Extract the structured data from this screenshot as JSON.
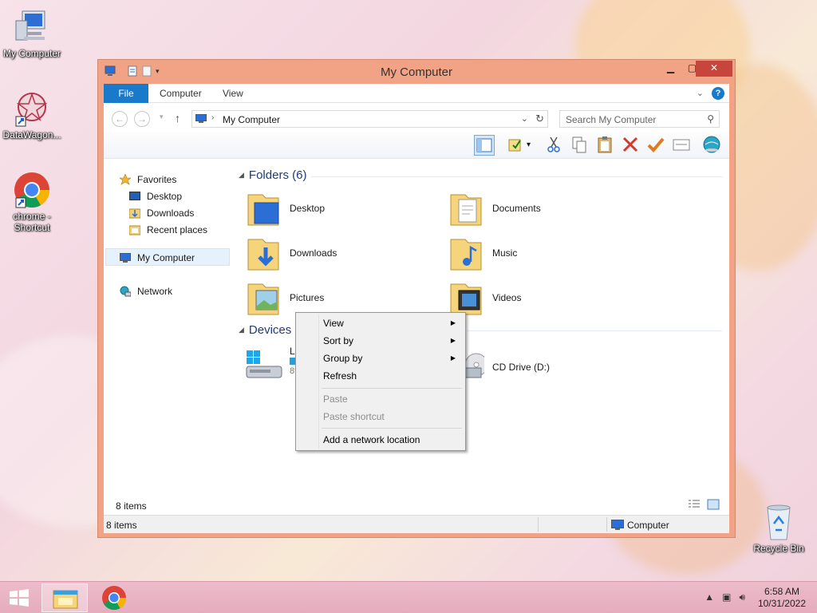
{
  "desktop": {
    "icons": [
      {
        "label": "My Computer"
      },
      {
        "label": "DataWagon..."
      },
      {
        "label": "chrome - Shortcut"
      },
      {
        "label": "Recycle Bin"
      }
    ]
  },
  "window": {
    "title": "My Computer",
    "ribbon_tabs": {
      "file": "File",
      "computer": "Computer",
      "view": "View"
    },
    "address": {
      "path": "My Computer"
    },
    "search": {
      "placeholder": "Search My Computer"
    },
    "nav": {
      "favorites": "Favorites",
      "desktop": "Desktop",
      "downloads": "Downloads",
      "recent": "Recent places",
      "my_computer": "My Computer",
      "network": "Network"
    },
    "groups": {
      "folders": "Folders (6)",
      "devices": "Devices a"
    },
    "folders": [
      "Desktop",
      "Documents",
      "Downloads",
      "Music",
      "Pictures",
      "Videos"
    ],
    "devices": {
      "local_disk_partial": "Lo",
      "local_disk_size_partial": "89",
      "cd_drive": "CD Drive (D:)"
    },
    "item_count": "8 items",
    "statusbar": {
      "left": "8 items",
      "right": "Computer"
    }
  },
  "context_menu": {
    "items": [
      {
        "label": "View",
        "submenu": true,
        "disabled": false
      },
      {
        "label": "Sort by",
        "submenu": true,
        "disabled": false
      },
      {
        "label": "Group by",
        "submenu": true,
        "disabled": false
      },
      {
        "label": "Refresh",
        "submenu": false,
        "disabled": false
      },
      {
        "label": "Paste",
        "submenu": false,
        "disabled": true
      },
      {
        "label": "Paste shortcut",
        "submenu": false,
        "disabled": true
      },
      {
        "label": "Add a network location",
        "submenu": false,
        "disabled": false
      }
    ]
  },
  "taskbar": {
    "time": "6:58 AM",
    "date": "10/31/2022"
  },
  "colors": {
    "accent": "#1979ca",
    "window_frame": "#f2a385",
    "close": "#c7453c",
    "taskbar": "#e9b5c4"
  }
}
